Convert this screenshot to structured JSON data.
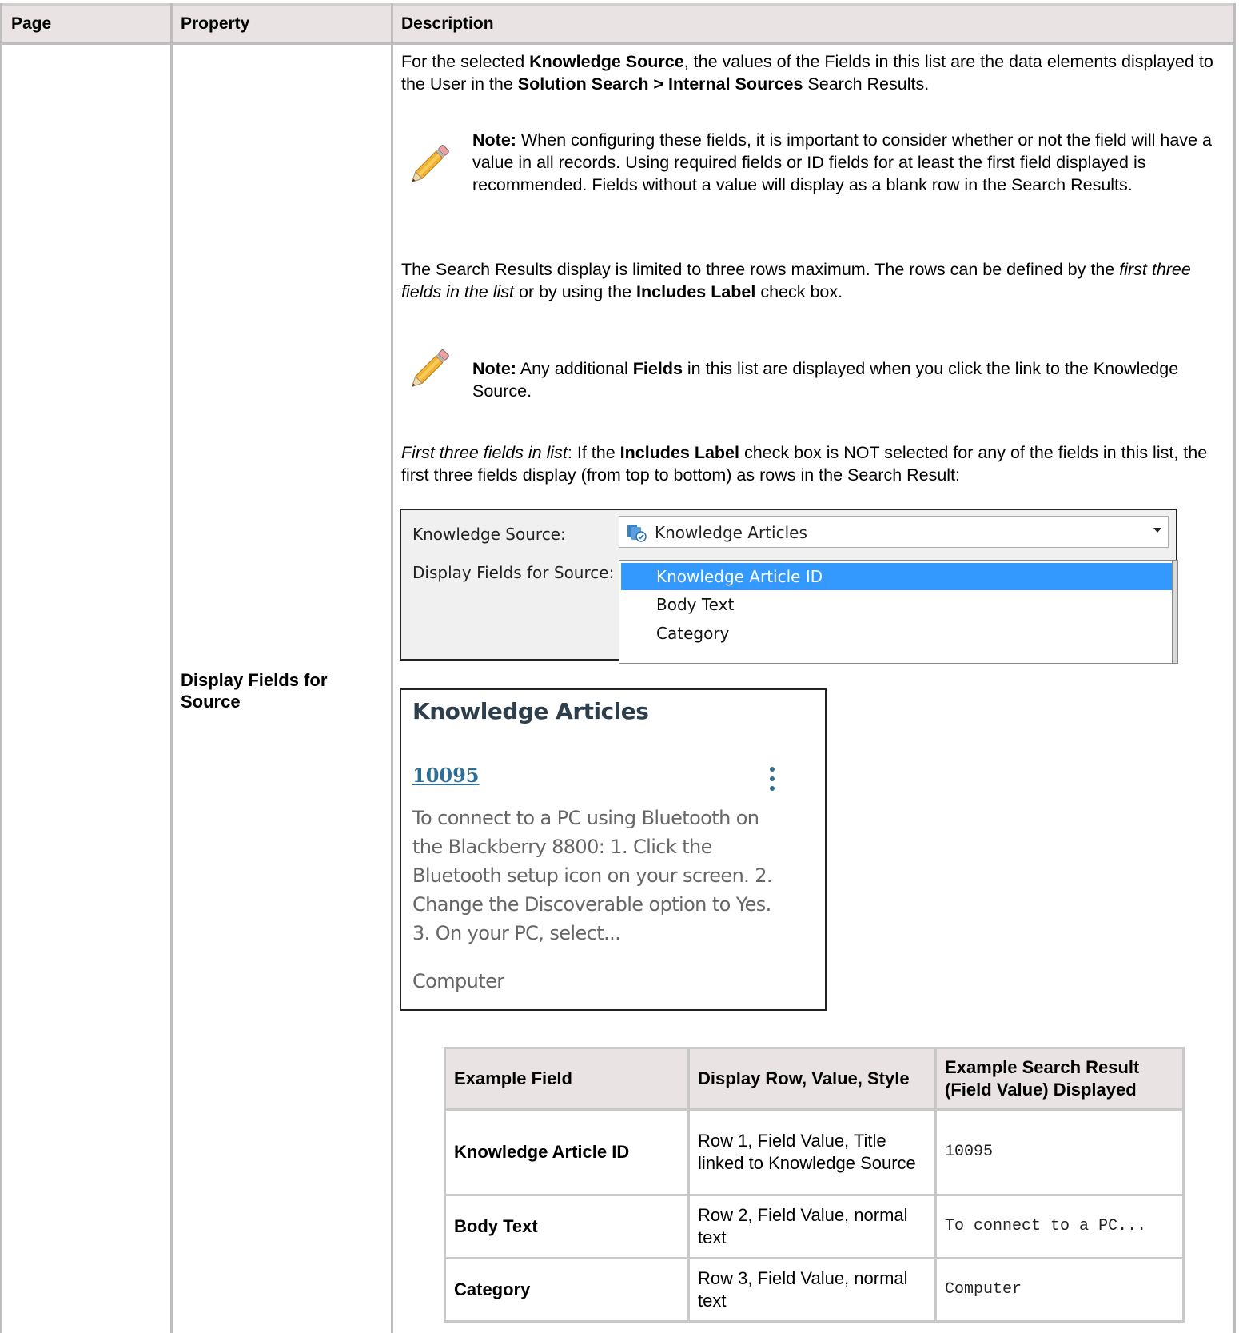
{
  "table": {
    "headers": [
      "Page",
      "Property",
      "Description"
    ],
    "property": "Display Fields for Source"
  },
  "desc": {
    "p1": [
      {
        "t": "For the selected ",
        "b": false
      },
      {
        "t": "Knowledge Source",
        "b": true
      },
      {
        "t": ", the values of the Fields in this list are the data elements displayed to the User in the ",
        "b": false
      },
      {
        "t": "Solution Search > Internal Sources",
        "b": true
      },
      {
        "t": " Search Results.",
        "b": false
      }
    ],
    "note1_label": "Note:",
    "note1_text": " When configuring these fields, it is important to consider whether or not the field will have a value in all records. Using required fields or ID fields for at least the first field displayed is recommended. Fields without a value will display as a blank row in the Search Results.",
    "p2_a": "The Search Results display is limited to three rows maximum. The rows can be defined by the ",
    "p2_b": "first three fields in the list",
    "p2_c": " or by using the ",
    "p2_d": "Includes Label",
    "p2_e": " check box.",
    "note2_label": "Note:",
    "note2_a": " Any additional ",
    "note2_b": "Fields",
    "note2_c": " in this list are displayed when you click the link to the Knowledge Source.",
    "p3_a": "First three fields in list",
    "p3_b": ": If the ",
    "p3_c": "Includes Label",
    "p3_d": " check box is NOT selected for any of the fields in this list, the first three fields display (from top to bottom) as rows in the Search Result:"
  },
  "form": {
    "knowledge_source_label": "Knowledge Source:",
    "knowledge_source_value": "Knowledge Articles",
    "display_fields_label": "Display Fields for Source:",
    "fields": [
      "Knowledge Article ID",
      "Body Text",
      "Category"
    ],
    "selected_index": 0,
    "icon": "knowledge-articles-icon"
  },
  "card": {
    "title": "Knowledge Articles",
    "link": "10095",
    "body": "To connect to a PC using Bluetooth on the Blackberry 8800:  1.    Click the Bluetooth setup icon on your screen.    2.    Change the Discoverable option to Yes.        3.    On your PC, select...",
    "category": "Computer",
    "menu_icon": "kebab-menu-icon"
  },
  "example_table": {
    "headers": [
      "Example Field",
      "Display Row, Value, Style",
      "Example Search Result (Field Value) Displayed"
    ],
    "rows": [
      {
        "field": "Knowledge Article ID",
        "display": "Row 1, Field Value, Title linked to Knowledge Source",
        "result": "10095"
      },
      {
        "field": "Body Text",
        "display": "Row 2, Field Value, normal text",
        "result": "To connect to a PC..."
      },
      {
        "field": "Category",
        "display": "Row 3, Field Value, normal text",
        "result": "Computer"
      }
    ]
  },
  "colors": {
    "header_bg": "#e9e4e3",
    "border": "#bdbdbd",
    "selection": "#3399ff",
    "card_title": "#2d3e4c",
    "card_link": "#2f6f94"
  }
}
